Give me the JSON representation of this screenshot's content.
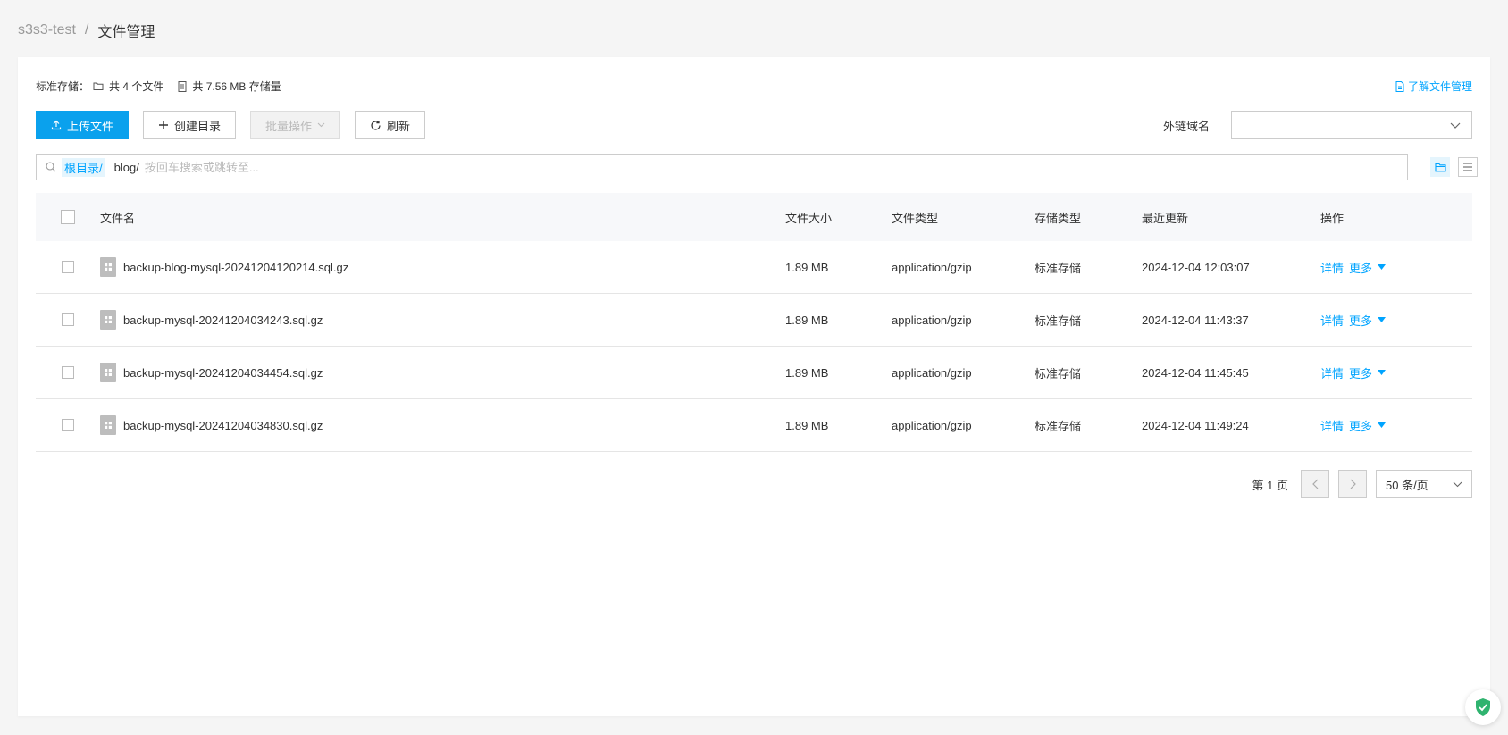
{
  "breadcrumb": {
    "bucket": "s3s3-test",
    "separator": "/",
    "current": "文件管理"
  },
  "summary": {
    "label": "标准存储：",
    "file_count": "共 4 个文件",
    "storage_used": "共 7.56 MB 存储量"
  },
  "learn_link": "了解文件管理",
  "toolbar": {
    "upload": "上传文件",
    "create_dir": "创建目录",
    "batch": "批量操作",
    "refresh": "刷新"
  },
  "domain": {
    "label": "外链域名",
    "value": ""
  },
  "search": {
    "root": "根目录/",
    "path": "blog/",
    "placeholder": "按回车搜索或跳转至..."
  },
  "table": {
    "headers": {
      "name": "文件名",
      "size": "文件大小",
      "type": "文件类型",
      "storage": "存储类型",
      "updated": "最近更新",
      "actions": "操作"
    },
    "rows": [
      {
        "name": "backup-blog-mysql-20241204120214.sql.gz",
        "size": "1.89 MB",
        "type": "application/gzip",
        "storage": "标准存储",
        "updated": "2024-12-04 12:03:07",
        "detail": "详情",
        "more": "更多"
      },
      {
        "name": "backup-mysql-20241204034243.sql.gz",
        "size": "1.89 MB",
        "type": "application/gzip",
        "storage": "标准存储",
        "updated": "2024-12-04 11:43:37",
        "detail": "详情",
        "more": "更多"
      },
      {
        "name": "backup-mysql-20241204034454.sql.gz",
        "size": "1.89 MB",
        "type": "application/gzip",
        "storage": "标准存储",
        "updated": "2024-12-04 11:45:45",
        "detail": "详情",
        "more": "更多"
      },
      {
        "name": "backup-mysql-20241204034830.sql.gz",
        "size": "1.89 MB",
        "type": "application/gzip",
        "storage": "标准存储",
        "updated": "2024-12-04 11:49:24",
        "detail": "详情",
        "more": "更多"
      }
    ]
  },
  "pagination": {
    "page_label": "第 1 页",
    "page_size": "50 条/页"
  },
  "colors": {
    "primary": "#0aa1ed",
    "link": "#00a4ff",
    "shield": "#2fb36f"
  }
}
